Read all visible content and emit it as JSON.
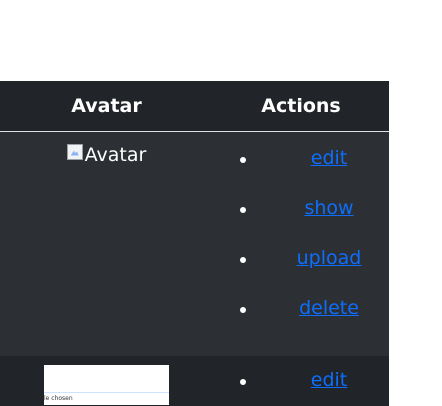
{
  "table": {
    "headers": {
      "avatar": "Avatar",
      "actions": "Actions"
    },
    "rows": [
      {
        "avatar_alt": "Avatar",
        "actions": [
          "edit",
          "show",
          "upload",
          "delete"
        ]
      },
      {
        "thumb_text": "le chosen",
        "actions": [
          "edit"
        ]
      }
    ]
  },
  "colors": {
    "header_bg": "#212529",
    "row_odd_bg": "#2c3034",
    "row_even_bg": "#212529",
    "link": "#0d6efd",
    "text": "#ffffff"
  }
}
